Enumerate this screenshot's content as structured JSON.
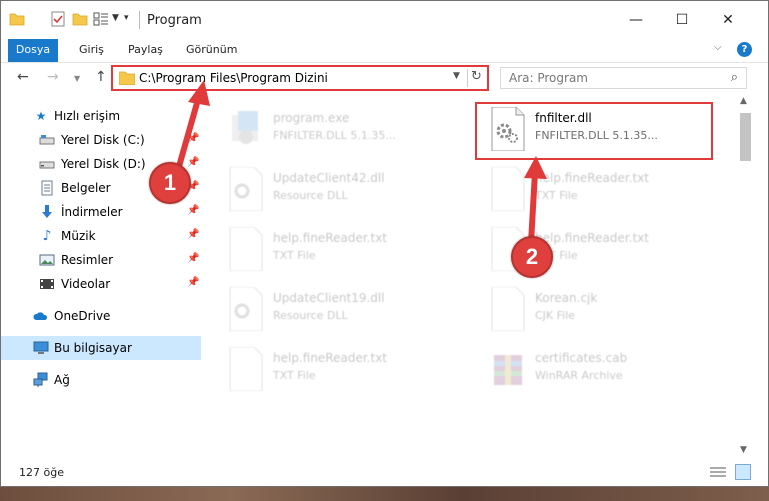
{
  "window": {
    "title": "Program",
    "min_glyph": "—",
    "max_glyph": "☐",
    "close_glyph": "✕"
  },
  "ribbon": {
    "tabs": [
      "Dosya",
      "Giriş",
      "Paylaş",
      "Görünüm"
    ],
    "accent": "#1979ca",
    "help_glyph": "?"
  },
  "address": {
    "path": "C:\\Program Files\\Program Dizini",
    "search_placeholder": "Ara: Program"
  },
  "nav": {
    "items": [
      {
        "label": "Hızlı erişim",
        "icon": "star-icon"
      },
      {
        "label": "Yerel Disk (C:)",
        "icon": "drive-icon",
        "pinned": true
      },
      {
        "label": "Yerel Disk (D:)",
        "icon": "drive-icon",
        "pinned": true
      },
      {
        "label": "Belgeler",
        "icon": "documents-icon",
        "pinned": true
      },
      {
        "label": "İndirmeler",
        "icon": "download-icon",
        "pinned": true
      },
      {
        "label": "Müzik",
        "icon": "music-icon",
        "pinned": true
      },
      {
        "label": "Resimler",
        "icon": "pictures-icon",
        "pinned": true
      },
      {
        "label": "Videolar",
        "icon": "videos-icon",
        "pinned": true
      },
      {
        "label": "OneDrive",
        "icon": "cloud-icon"
      },
      {
        "label": "Bu bilgisayar",
        "icon": "computer-icon",
        "selected": true
      },
      {
        "label": "Ağ",
        "icon": "network-icon"
      }
    ]
  },
  "files": [
    {
      "name": "program.exe",
      "desc": "FNFILTER.DLL 5.1.35...",
      "icon": "exe-icon",
      "faded": true
    },
    {
      "name": "fnfilter.dll",
      "desc": "FNFILTER.DLL 5.1.35...",
      "icon": "dll-icon",
      "faded": false
    },
    {
      "name": "UpdateClient42.dll",
      "desc": "Resource DLL",
      "icon": "dll-icon",
      "faded": true
    },
    {
      "name": "help.fineReader.txt",
      "desc": "TXT File",
      "icon": "text-file-icon",
      "faded": true
    },
    {
      "name": "help.fineReader.txt",
      "desc": "TXT File",
      "icon": "text-file-icon",
      "faded": true
    },
    {
      "name": "help.fineReader.txt",
      "desc": "TXT File",
      "icon": "text-file-icon",
      "faded": true
    },
    {
      "name": "UpdateClient19.dll",
      "desc": "Resource DLL",
      "icon": "dll-icon",
      "faded": true
    },
    {
      "name": "Korean.cjk",
      "desc": "CJK File",
      "icon": "blank-file-icon",
      "faded": true
    },
    {
      "name": "help.fineReader.txt",
      "desc": "TXT File",
      "icon": "text-file-icon",
      "faded": true
    },
    {
      "name": "certificates.cab",
      "desc": "WinRAR Archive",
      "icon": "archive-icon",
      "faded": true
    }
  ],
  "status": {
    "item_count": "127 öğe"
  },
  "annotations": {
    "badge_1": "1",
    "badge_2": "2",
    "color": "#e03a3a"
  }
}
